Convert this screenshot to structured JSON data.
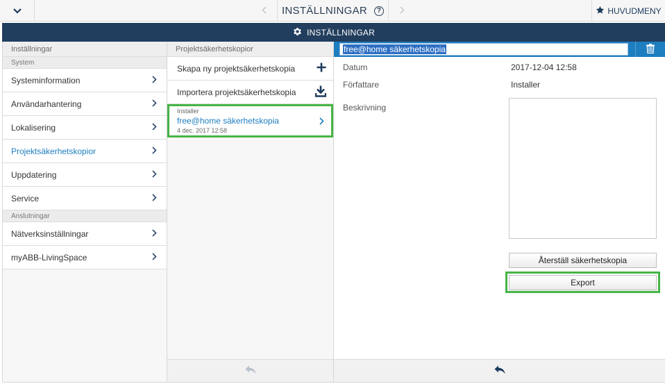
{
  "topbar": {
    "collapse_icon": "chevron-down-icon",
    "prev_icon": "chevron-left-icon",
    "title": "INSTÄLLNINGAR",
    "help_icon": "question-circle-icon",
    "help_glyph": "?",
    "next_icon": "chevron-right-icon",
    "main_menu_icon": "star-icon",
    "main_menu_label": "HUVUDMENY"
  },
  "header": {
    "icon": "gear-icon",
    "title": "INSTÄLLNINGAR"
  },
  "left": {
    "title": "Inställningar",
    "group_system": "System",
    "items_system": [
      {
        "label": "Systeminformation"
      },
      {
        "label": "Användarhantering"
      },
      {
        "label": "Lokalisering"
      },
      {
        "label": "Projektsäkerhetskopior"
      },
      {
        "label": "Uppdatering"
      },
      {
        "label": "Service"
      }
    ],
    "group_connections": "Anslutningar",
    "items_connections": [
      {
        "label": "Nätverksinställningar"
      },
      {
        "label": "myABB-LivingSpace"
      }
    ]
  },
  "middle": {
    "title": "Projektsäkerhetskopior",
    "create_label": "Skapa ny projektsäkerhetskopia",
    "import_label": "Importera projektsäkerhetskopia",
    "backup": {
      "author": "Installer",
      "name": "free@home säkerhetskopia",
      "date": "4 dec. 2017 12:58"
    },
    "footer_icon": "reply-arrow-icon"
  },
  "right": {
    "name_value": "free@home säkerhetskopia",
    "trash_icon": "trash-icon",
    "date_label": "Datum",
    "date_value": "2017-12-04 12:58",
    "author_label": "Författare",
    "author_value": "Installer",
    "description_label": "Beskrivning",
    "description_value": "",
    "restore_button": "Återställ säkerhetskopia",
    "export_button": "Export",
    "footer_icon": "reply-arrow-icon"
  },
  "colors": {
    "dark_header": "#223e5e",
    "accent_blue": "#1d7ec0",
    "highlight_green": "#46b446"
  }
}
